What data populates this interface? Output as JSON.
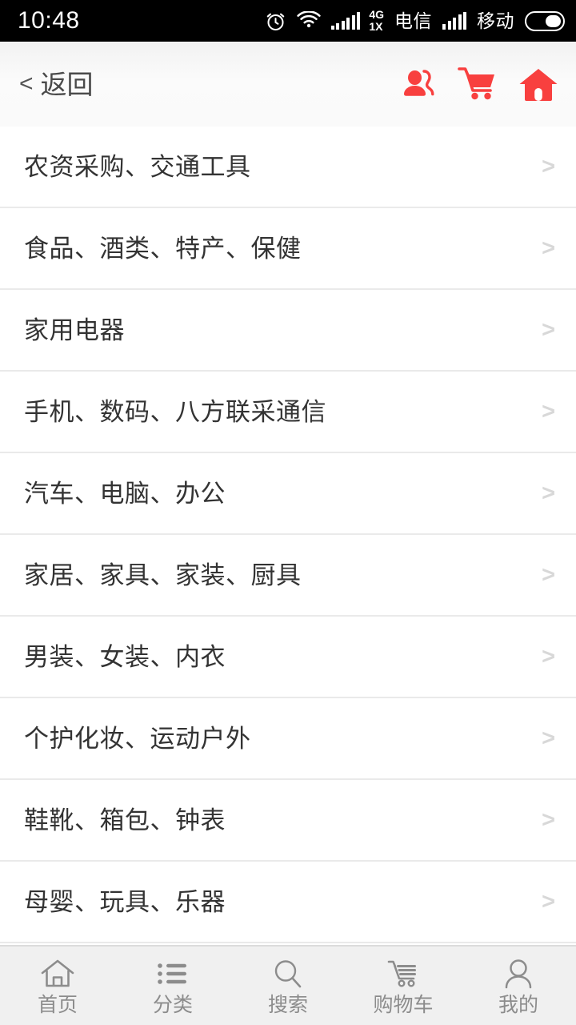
{
  "status_bar": {
    "time": "10:48",
    "alarm_icon": "alarm-clock-icon",
    "wifi_icon": "wifi-icon",
    "network_gen_top": "4G",
    "network_gen_bottom": "1X",
    "carrier_1": "电信",
    "carrier_2": "移动",
    "battery_icon": "battery-icon"
  },
  "header": {
    "back_chevron": "<",
    "back_label": "返回",
    "actions": [
      {
        "name": "contacts-icon",
        "label": "联系人"
      },
      {
        "name": "cart-icon",
        "label": "购物车"
      },
      {
        "name": "home-icon",
        "label": "首页"
      }
    ],
    "accent_color": "#f8403f"
  },
  "categories": {
    "arrow": ">",
    "items": [
      {
        "label": "农资采购、交通工具"
      },
      {
        "label": "食品、酒类、特产、保健"
      },
      {
        "label": "家用电器"
      },
      {
        "label": "手机、数码、八方联采通信"
      },
      {
        "label": "汽车、电脑、办公"
      },
      {
        "label": "家居、家具、家装、厨具"
      },
      {
        "label": "男装、女装、内衣"
      },
      {
        "label": "个护化妆、运动户外"
      },
      {
        "label": "鞋靴、箱包、钟表"
      },
      {
        "label": "母婴、玩具、乐器"
      }
    ]
  },
  "tabbar": {
    "items": [
      {
        "label": "首页",
        "icon": "home-outline-icon"
      },
      {
        "label": "分类",
        "icon": "list-outline-icon"
      },
      {
        "label": "搜索",
        "icon": "search-outline-icon"
      },
      {
        "label": "购物车",
        "icon": "cart-outline-icon"
      },
      {
        "label": "我的",
        "icon": "person-outline-icon"
      }
    ],
    "inactive_color": "#8c8c8c"
  }
}
